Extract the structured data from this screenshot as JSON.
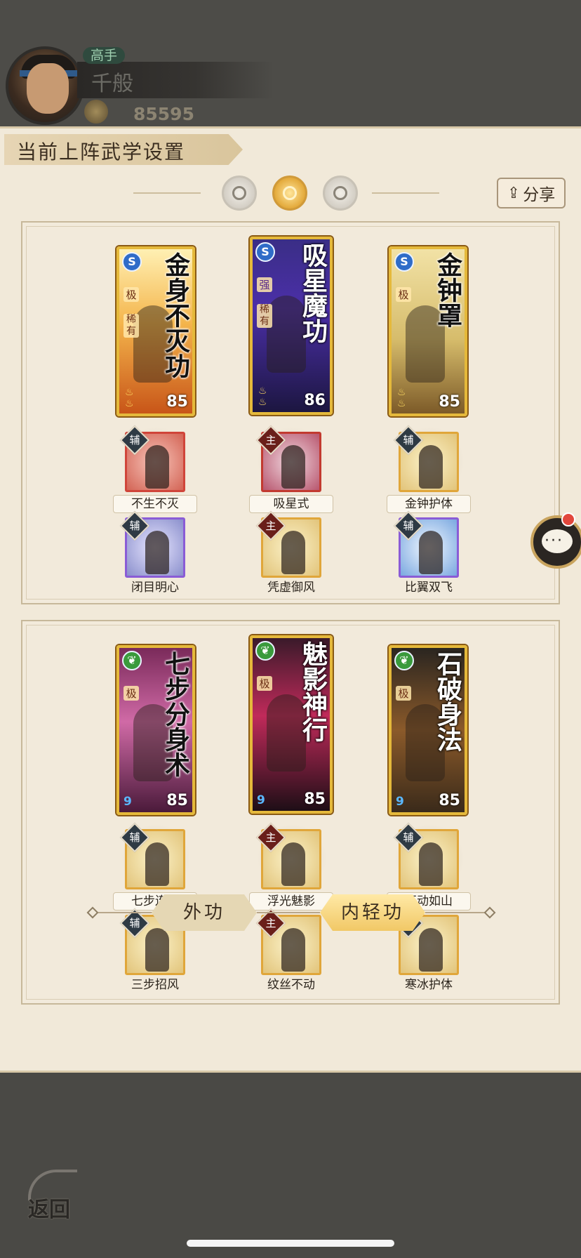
{
  "player": {
    "rank": "高手",
    "name": "千般",
    "power": "85595"
  },
  "panel": {
    "title": "当前上阵武学设置",
    "share_label": "分享",
    "share_icon": "share-arrow-icon"
  },
  "tiers": [
    {
      "name": "moon-orb",
      "active": false
    },
    {
      "name": "sun-orb",
      "active": true
    },
    {
      "name": "ring-orb",
      "active": false
    }
  ],
  "loadout_1": {
    "cards": [
      {
        "title": "金身不灭功",
        "type_icon": "S",
        "grades": [
          "极",
          "稀有"
        ],
        "level": "85"
      },
      {
        "title": "吸星魔功",
        "type_icon": "S",
        "grades": [
          "强",
          "稀有"
        ],
        "level": "86"
      },
      {
        "title": "金钟罩",
        "type_icon": "S",
        "grades": [
          "极"
        ],
        "level": "85"
      }
    ],
    "skills_row1": [
      {
        "tag": "辅",
        "label": "不生不灭"
      },
      {
        "tag": "主",
        "label": "吸星式"
      },
      {
        "tag": "辅",
        "label": "金钟护体"
      }
    ],
    "skills_row2": [
      {
        "tag": "辅",
        "label": "闭目明心"
      },
      {
        "tag": "主",
        "label": "凭虚御风"
      },
      {
        "tag": "辅",
        "label": "比翼双飞"
      }
    ]
  },
  "loadout_2": {
    "cards": [
      {
        "title": "七步分身术",
        "type_icon": "leaf",
        "grades": [
          "极"
        ],
        "level": "85",
        "nine": "9"
      },
      {
        "title": "魅影神行",
        "type_icon": "leaf",
        "grades": [
          "极"
        ],
        "level": "85",
        "nine": "9"
      },
      {
        "title": "石破身法",
        "type_icon": "leaf",
        "grades": [
          "极"
        ],
        "level": "85",
        "nine": "9"
      }
    ],
    "skills_row1": [
      {
        "tag": "辅",
        "label": "七步连身"
      },
      {
        "tag": "主",
        "label": "浮光魅影"
      },
      {
        "tag": "辅",
        "label": "不动如山"
      }
    ],
    "skills_row2": [
      {
        "tag": "辅",
        "label": "三步招风"
      },
      {
        "tag": "主",
        "label": "纹丝不动"
      },
      {
        "tag": "辅",
        "label": "寒冰护体"
      }
    ]
  },
  "tabs": {
    "outer": "外功",
    "inner": "内轻功",
    "active": "inner"
  },
  "nav": {
    "back_label": "返回"
  },
  "colors": {
    "panel_bg": "#f1e9d9",
    "card_border": "#e5b93b",
    "tab_active": "#f1c866"
  }
}
